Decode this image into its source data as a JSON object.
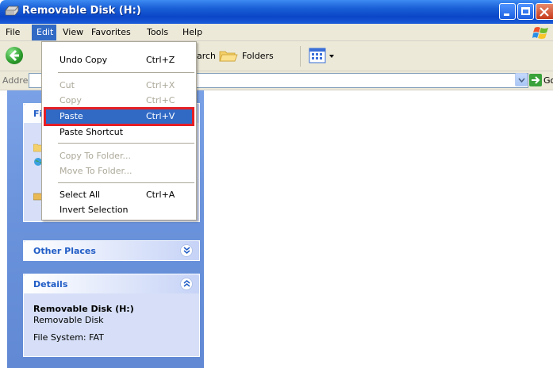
{
  "window": {
    "title": "Removable Disk (H:)"
  },
  "menubar": {
    "items": [
      "File",
      "Edit",
      "View",
      "Favorites",
      "Tools",
      "Help"
    ]
  },
  "toolbar": {
    "search_label": "Search",
    "folders_label": "Folders"
  },
  "addressbar": {
    "label": "Address",
    "go_label": "Go"
  },
  "edit_menu": {
    "undo": {
      "label": "Undo Copy",
      "shortcut": "Ctrl+Z"
    },
    "cut": {
      "label": "Cut",
      "shortcut": "Ctrl+X"
    },
    "copy": {
      "label": "Copy",
      "shortcut": "Ctrl+C"
    },
    "paste": {
      "label": "Paste",
      "shortcut": "Ctrl+V"
    },
    "paste_shortcut": {
      "label": "Paste Shortcut"
    },
    "copy_to_folder": {
      "label": "Copy To Folder..."
    },
    "move_to_folder": {
      "label": "Move To Folder..."
    },
    "select_all": {
      "label": "Select All",
      "shortcut": "Ctrl+A"
    },
    "invert_selection": {
      "label": "Invert Selection"
    }
  },
  "taskpane": {
    "file_tasks_title": "Fi",
    "other_places_title": "Other Places",
    "details_title": "Details",
    "details_name": "Removable Disk (H:)",
    "details_type": "Removable Disk",
    "details_fs": "File System: FAT"
  },
  "colors": {
    "highlight": "#316ac5",
    "annotation_frame": "#e51e25",
    "panel_title": "#215dc6"
  }
}
